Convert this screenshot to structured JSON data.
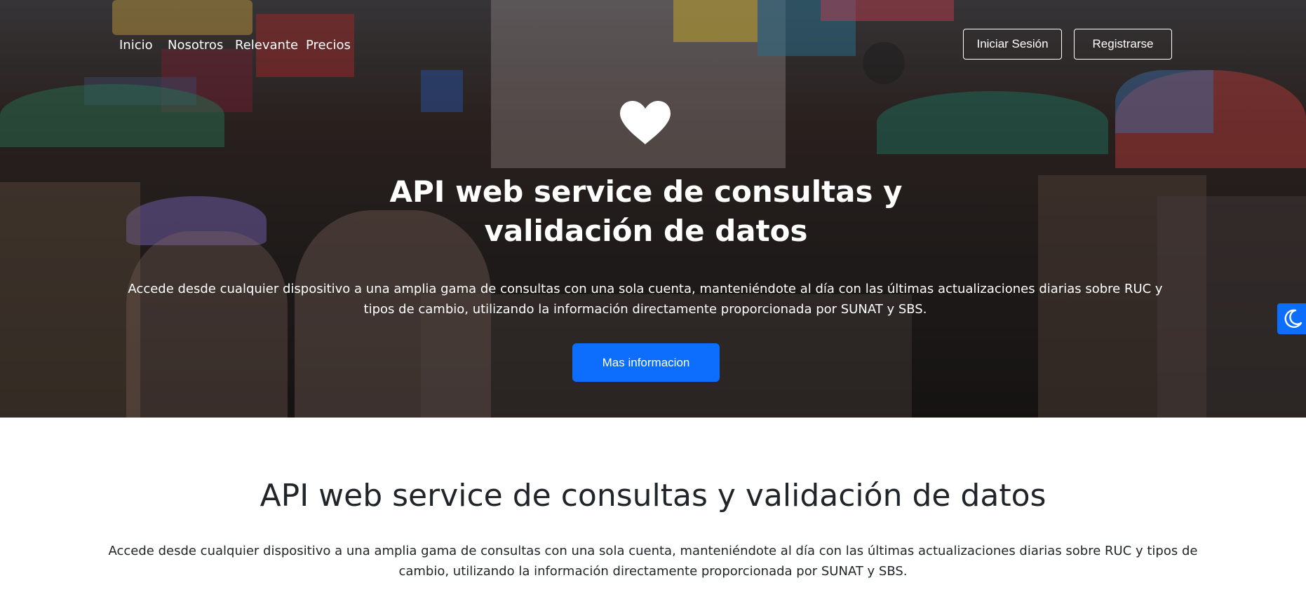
{
  "nav": {
    "links": [
      "Inicio",
      "Nosotros",
      "Relevante",
      "Precios"
    ],
    "login_label": "Iniciar Sesión",
    "register_label": "Registrarse"
  },
  "hero": {
    "icon": "heart-icon",
    "title": "API web service de consultas y validación de datos",
    "text": "Accede desde cualquier dispositivo a una amplia gama de consultas con una sola cuenta, manteniéndote al día con las últimas actualizaciones diarias sobre RUC y tipos de cambio, utilizando la información directamente proporcionada por SUNAT y SBS.",
    "button_label": "Mas informacion"
  },
  "section": {
    "title": "API web service de consultas y validación de datos",
    "text": "Accede desde cualquier dispositivo a una amplia gama de consultas con una sola cuenta, manteniéndote al día con las últimas actualizaciones diarias sobre RUC y tipos de cambio, utilizando la información directamente proporcionada por SUNAT y SBS."
  },
  "theme_toggle": {
    "icon": "moon-icon"
  },
  "colors": {
    "primary": "#0d6efd",
    "text": "#212529",
    "hero_text": "#ffffff"
  }
}
